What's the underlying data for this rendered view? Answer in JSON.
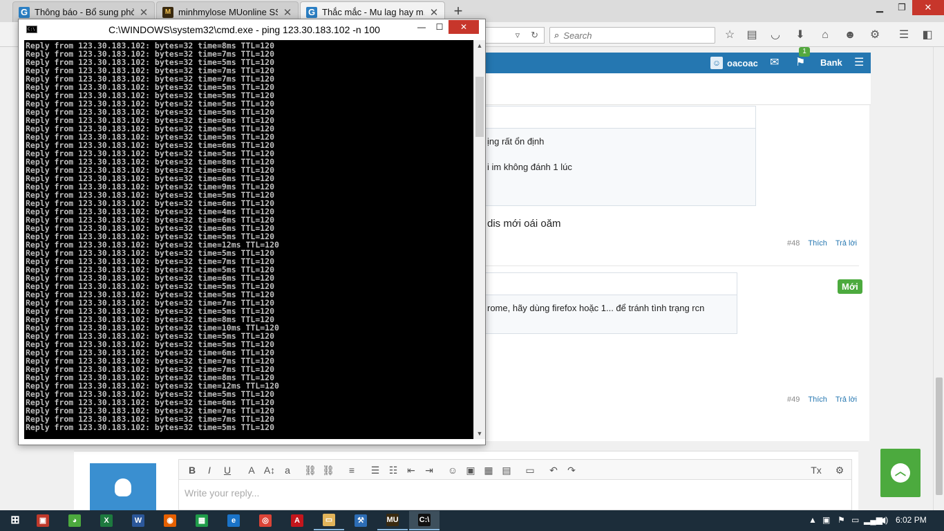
{
  "browser": {
    "tabs": [
      {
        "title": "Thông báo - Bổ sung phò...",
        "icon": "site-g-icon",
        "active": false
      },
      {
        "title": "minhmylose MUonline SS...",
        "icon": "mu-game-icon",
        "active": false
      },
      {
        "title": "Thắc mắc - Mu lag hay m...",
        "icon": "site-g-icon",
        "active": true
      }
    ],
    "new_tab_symbol": "+",
    "search_placeholder": "Search"
  },
  "site": {
    "username": "oacoac",
    "bank_label": "Bank",
    "notification_count": "1"
  },
  "posts": [
    {
      "quote_lines": [
        "ịng rất ổn định",
        "i im không đánh 1 lúc"
      ],
      "text": "dis mới oái oăm",
      "number": "#48",
      "like": "Thích",
      "reply": "Trả lời"
    },
    {
      "quote_lines": [
        "rome, hãy dùng firefox hoặc 1... để tránh tình trạng rcn"
      ],
      "text": "",
      "number": "#49",
      "like": "Thích",
      "reply": "Trả lời"
    }
  ],
  "new_badge": "Mới",
  "reply_box": {
    "placeholder": "Write your reply..."
  },
  "cmd": {
    "title": "C:\\WINDOWS\\system32\\cmd.exe - ping  123.30.183.102 -n 100",
    "host": "123.30.183.102",
    "bytes": "32",
    "ttl": "120",
    "times_ms": [
      8,
      7,
      5,
      7,
      7,
      5,
      5,
      5,
      5,
      6,
      5,
      5,
      6,
      5,
      8,
      6,
      6,
      9,
      5,
      6,
      4,
      6,
      6,
      5,
      12,
      5,
      7,
      5,
      6,
      5,
      5,
      7,
      5,
      8,
      10,
      5,
      5,
      6,
      7,
      7,
      8,
      12,
      5,
      6,
      7,
      7,
      5
    ]
  },
  "taskbar": {
    "clock": "6:02 PM",
    "apps": [
      {
        "name": "start",
        "label": "⊞"
      },
      {
        "name": "teamviewer-like",
        "label": "▣"
      },
      {
        "name": "green-app",
        "label": "◕"
      },
      {
        "name": "excel",
        "label": "X"
      },
      {
        "name": "word",
        "label": "W"
      },
      {
        "name": "firefox",
        "label": "◉"
      },
      {
        "name": "green-box",
        "label": "▦"
      },
      {
        "name": "ie",
        "label": "e"
      },
      {
        "name": "chrome",
        "label": "◎"
      },
      {
        "name": "acrobat",
        "label": "A"
      },
      {
        "name": "explorer",
        "label": "▭"
      },
      {
        "name": "tool",
        "label": "⚒"
      },
      {
        "name": "mu",
        "label": "MU"
      },
      {
        "name": "cmd",
        "label": "C:\\"
      }
    ]
  },
  "colors": {
    "site_blue": "#2577b1",
    "accent_green": "#4caa3e",
    "cmd_bg": "#000000",
    "cmd_fg": "#c0c0c0",
    "taskbar": "#1c2d3a"
  }
}
